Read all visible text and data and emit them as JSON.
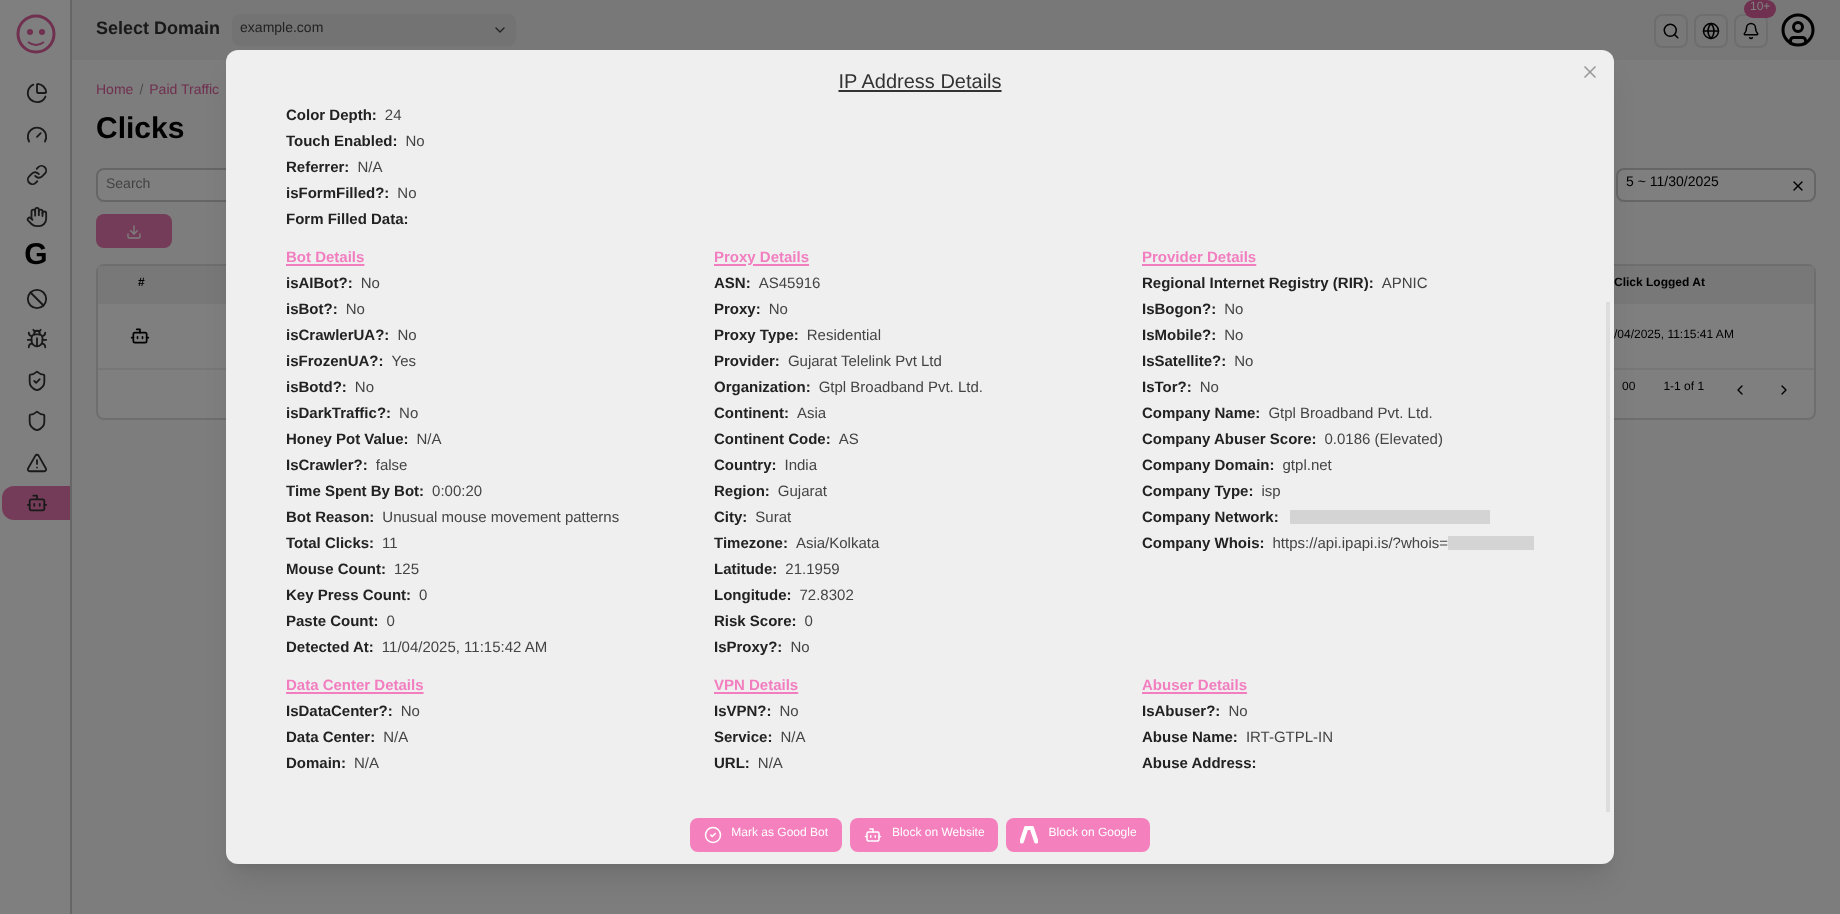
{
  "sidebar": {
    "items": [
      {
        "kind": "pie",
        "selected": false
      },
      {
        "kind": "gauge",
        "selected": false
      },
      {
        "kind": "link",
        "selected": false
      },
      {
        "kind": "hand",
        "selected": false
      },
      {
        "kind": "letter",
        "text": "G",
        "selected": false
      },
      {
        "kind": "ban",
        "selected": false
      },
      {
        "kind": "bug",
        "selected": false
      },
      {
        "kind": "shield-check",
        "selected": false
      },
      {
        "kind": "shield",
        "selected": false
      },
      {
        "kind": "warning",
        "selected": false
      },
      {
        "kind": "bot",
        "selected": true
      }
    ]
  },
  "header": {
    "domain_label": "Select Domain",
    "domain_value": "example.com",
    "notification_badge": "10+"
  },
  "breadcrumb": {
    "items": [
      "Home",
      "Paid Traffic"
    ],
    "separator": "/"
  },
  "page_title": "Clicks",
  "search": {
    "placeholder": "Search"
  },
  "date_range": {
    "value": "5 ~ 11/30/2025"
  },
  "table": {
    "columns": [
      "#",
      "Click Logged At"
    ],
    "rows": [
      [
        null,
        "/04/2025, 11:15:41 AM"
      ]
    ]
  },
  "pagination": {
    "rows_per_page": "00",
    "range": "1-1 of 1"
  },
  "modal": {
    "title": "IP Address Details",
    "general": [
      {
        "label": "Color Depth:",
        "value": "24"
      },
      {
        "label": "Touch Enabled:",
        "value": "No"
      },
      {
        "label": "Referrer:",
        "value": "N/A"
      },
      {
        "label": "isFormFilled?:",
        "value": "No"
      },
      {
        "label": "Form Filled Data:"
      }
    ],
    "section_rows": [
      [
        {
          "title": "Bot Details",
          "fields": [
            {
              "label": "isAIBot?:",
              "value": "No"
            },
            {
              "label": "isBot?:",
              "value": "No"
            },
            {
              "label": "isCrawlerUA?:",
              "value": "No"
            },
            {
              "label": "isFrozenUA?:",
              "value": "Yes"
            },
            {
              "label": "isBotd?:",
              "value": "No"
            },
            {
              "label": "isDarkTraffic?:",
              "value": "No"
            },
            {
              "label": "Honey Pot Value:",
              "value": "N/A"
            },
            {
              "label": "IsCrawler?:",
              "value": "false"
            },
            {
              "label": "Time Spent By Bot:",
              "value": "0:00:20"
            },
            {
              "label": "Bot Reason:",
              "value": "Unusual mouse movement patterns"
            },
            {
              "label": "Total Clicks:",
              "value": "11"
            },
            {
              "label": "Mouse Count:",
              "value": "125"
            },
            {
              "label": "Key Press Count:",
              "value": "0"
            },
            {
              "label": "Paste Count:",
              "value": "0"
            },
            {
              "label": "Detected At:",
              "value": "11/04/2025, 11:15:42 AM"
            }
          ]
        },
        {
          "title": "Proxy Details",
          "fields": [
            {
              "label": "ASN:",
              "value": "AS45916"
            },
            {
              "label": "Proxy:",
              "value": "No"
            },
            {
              "label": "Proxy Type:",
              "value": "Residential"
            },
            {
              "label": "Provider:",
              "value": "Gujarat Telelink Pvt Ltd"
            },
            {
              "label": "Organization:",
              "value": "Gtpl Broadband Pvt. Ltd."
            },
            {
              "label": "Continent:",
              "value": "Asia"
            },
            {
              "label": "Continent Code:",
              "value": "AS"
            },
            {
              "label": "Country:",
              "value": "India"
            },
            {
              "label": "Region:",
              "value": "Gujarat"
            },
            {
              "label": "City:",
              "value": "Surat"
            },
            {
              "label": "Timezone:",
              "value": "Asia/Kolkata"
            },
            {
              "label": "Latitude:",
              "value": "21.1959"
            },
            {
              "label": "Longitude:",
              "value": "72.8302"
            },
            {
              "label": "Risk Score:",
              "value": "0"
            },
            {
              "label": "IsProxy?:",
              "value": "No"
            }
          ]
        },
        {
          "title": "Provider Details",
          "fields": [
            {
              "label": "Regional Internet Registry (RIR):",
              "value": "APNIC"
            },
            {
              "label": "IsBogon?:",
              "value": "No"
            },
            {
              "label": "IsMobile?:",
              "value": "No"
            },
            {
              "label": "IsSatellite?:",
              "value": "No"
            },
            {
              "label": "IsTor?:",
              "value": "No"
            },
            {
              "label": "Company Name:",
              "value": "Gtpl Broadband Pvt. Ltd."
            },
            {
              "label": "Company Abuser Score:",
              "value": "0.0186 (Elevated)"
            },
            {
              "label": "Company Domain:",
              "value": "gtpl.net"
            },
            {
              "label": "Company Type:",
              "value": "isp"
            },
            {
              "label": "Company Network:",
              "redacted": true
            },
            {
              "label": "Company Whois:",
              "value": "https://api.ipapi.is/?whois=",
              "redacted": true
            }
          ]
        }
      ],
      [
        {
          "title": "Data Center Details",
          "fields": [
            {
              "label": "IsDataCenter?:",
              "value": "No"
            },
            {
              "label": "Data Center:",
              "value": "N/A"
            },
            {
              "label": "Domain:",
              "value": "N/A"
            }
          ]
        },
        {
          "title": "VPN Details",
          "fields": [
            {
              "label": "IsVPN?:",
              "value": "No"
            },
            {
              "label": "Service:",
              "value": "N/A"
            },
            {
              "label": "URL:",
              "value": "N/A"
            }
          ]
        },
        {
          "title": "Abuser Details",
          "fields": [
            {
              "label": "IsAbuser?:",
              "value": "No"
            },
            {
              "label": "Abuse Name:",
              "value": "IRT-GTPL-IN"
            },
            {
              "label": "Abuse Address:"
            }
          ]
        }
      ]
    ],
    "buttons": [
      {
        "kind": "check",
        "label": "Mark as Good Bot"
      },
      {
        "kind": "bot",
        "label": "Block on Website"
      },
      {
        "kind": "google-ads",
        "label": "Block on Google"
      }
    ]
  }
}
